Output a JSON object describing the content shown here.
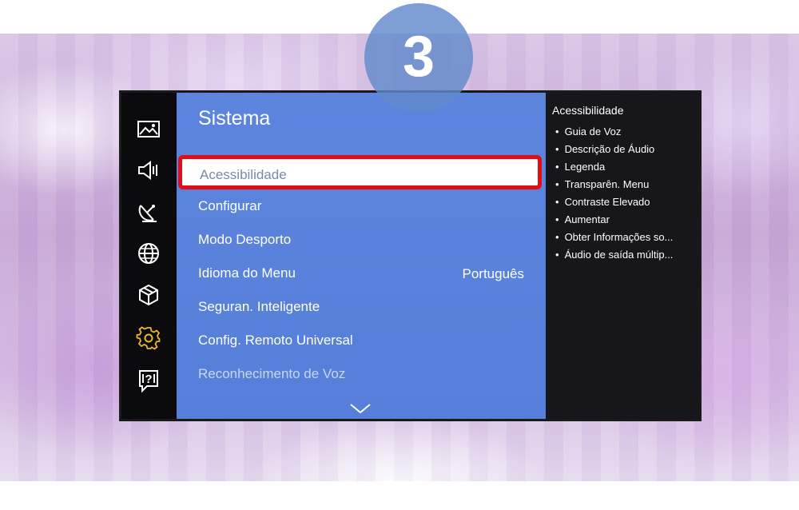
{
  "step_badge": "3",
  "menu": {
    "title": "Sistema",
    "selected": "Acessibilidade",
    "items": [
      {
        "label": "Configurar"
      },
      {
        "label": "Modo Desporto"
      },
      {
        "label": "Idioma do Menu",
        "value": "Português"
      },
      {
        "label": "Seguran. Inteligente"
      },
      {
        "label": "Config. Remoto Universal"
      },
      {
        "label": "Reconhecimento de Voz"
      }
    ]
  },
  "side_panel": {
    "title": "Acessibilidade",
    "items": [
      "Guia de Voz",
      "Descrição de Áudio",
      "Legenda",
      "Transparên. Menu",
      "Contraste Elevado",
      "Aumentar",
      "Obter Informações so...",
      "Áudio de saída múltip..."
    ]
  },
  "icons": [
    "picture-icon",
    "sound-icon",
    "broadcast-icon",
    "network-icon",
    "smart-hub-icon",
    "settings-gear-icon",
    "support-icon"
  ],
  "colors": {
    "menu_panel": "#5d85de",
    "highlight_border": "#e10f15",
    "active_icon": "#f0b429",
    "side_panel": "#16161b",
    "badge": "#628acc"
  }
}
